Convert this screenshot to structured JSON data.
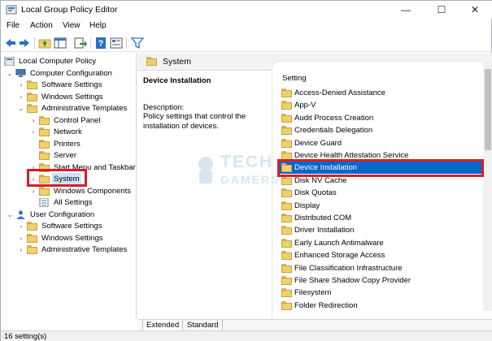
{
  "window": {
    "title": "Local Group Policy Editor",
    "minimize": "—",
    "maximize": "☐",
    "close": "✕"
  },
  "menu": [
    "File",
    "Action",
    "View",
    "Help"
  ],
  "toolbar": [
    "back-icon",
    "forward-icon",
    "up-folder-icon",
    "show-hide-tree-icon",
    "export-icon",
    "help-icon",
    "properties-icon",
    "filter-icon"
  ],
  "tree": {
    "root": "Local Computer Policy",
    "computer_config": "Computer Configuration",
    "cc_software": "Software Settings",
    "cc_windows": "Windows Settings",
    "cc_admin": "Administrative Templates",
    "control_panel": "Control Panel",
    "network": "Network",
    "printers": "Printers",
    "server": "Server",
    "start_menu": "Start Menu and Taskbar",
    "system": "System",
    "windows_components": "Windows Components",
    "all_settings": "All Settings",
    "user_config": "User Configuration",
    "uc_software": "Software Settings",
    "uc_windows": "Windows Settings",
    "uc_admin": "Administrative Templates"
  },
  "header": {
    "label": "System"
  },
  "description": {
    "title": "Device Installation",
    "heading": "Description:",
    "text": "Policy settings that control the installation of devices."
  },
  "list": {
    "column": "Setting",
    "items": [
      "Access-Denied Assistance",
      "App-V",
      "Audit Process Creation",
      "Credentials Delegation",
      "Device Guard",
      "Device Health Attestation Service",
      "Device Installation",
      "Disk NV Cache",
      "Disk Quotas",
      "Display",
      "Distributed COM",
      "Driver Installation",
      "Early Launch Antimalware",
      "Enhanced Storage Access",
      "File Classification Infrastructure",
      "File Share Shadow Copy Provider",
      "Filesystem",
      "Folder Redirection"
    ],
    "selected": "Device Installation"
  },
  "tabs": [
    "Extended",
    "Standard"
  ],
  "status": "16 setting(s)",
  "watermark": {
    "line1": "TECH",
    "line2": "GAMERS"
  },
  "colors": {
    "selection": "#0a66c8",
    "highlight_box": "#d21f2b",
    "folder": "#f1cf6c"
  }
}
